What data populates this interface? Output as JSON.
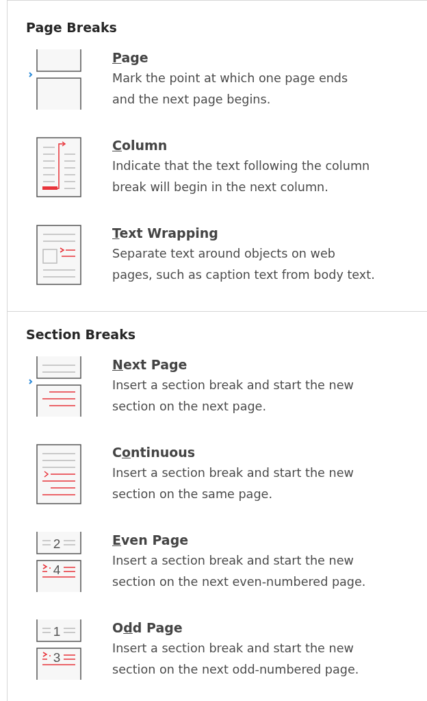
{
  "sections": [
    {
      "heading": "Page Breaks",
      "items": [
        {
          "kind": "page",
          "label": [
            {
              "text": "P",
              "underlined": true
            },
            {
              "text": "age",
              "underlined": false
            }
          ],
          "description": [
            "Mark the point at which one page ends",
            "and the next page begins."
          ]
        },
        {
          "kind": "column",
          "label": [
            {
              "text": "C",
              "underlined": true
            },
            {
              "text": "olumn",
              "underlined": false
            }
          ],
          "description": [
            "Indicate that the text following the column",
            "break will begin in the next column."
          ]
        },
        {
          "kind": "text_wrapping",
          "label": [
            {
              "text": "T",
              "underlined": true
            },
            {
              "text": "ext Wrapping",
              "underlined": false
            }
          ],
          "description": [
            "Separate text around objects on web",
            "pages, such as caption text from body text."
          ]
        }
      ]
    },
    {
      "heading": "Section Breaks",
      "items": [
        {
          "kind": "next_page",
          "label": [
            {
              "text": "N",
              "underlined": true
            },
            {
              "text": "ext Page",
              "underlined": false
            }
          ],
          "description": [
            "Insert a section break and start the new",
            "section on the next page."
          ]
        },
        {
          "kind": "continuous",
          "label": [
            {
              "text": "C",
              "underlined": false
            },
            {
              "text": "o",
              "underlined": true
            },
            {
              "text": "ntinuous",
              "underlined": false
            }
          ],
          "description": [
            "Insert a section break and start the new",
            "section on the same page."
          ]
        },
        {
          "kind": "numbered_page",
          "icon_numbers": [
            "2",
            "4"
          ],
          "label": [
            {
              "text": "E",
              "underlined": true
            },
            {
              "text": "ven Page",
              "underlined": false
            }
          ],
          "description": [
            "Insert a section break and start the new",
            "section on the next even-numbered page."
          ]
        },
        {
          "kind": "numbered_page",
          "icon_numbers": [
            "1",
            "3"
          ],
          "label": [
            {
              "text": "O",
              "underlined": false
            },
            {
              "text": "d",
              "underlined": true
            },
            {
              "text": "d Page",
              "underlined": false
            }
          ],
          "description": [
            "Insert a section break and start the new",
            "section on the next odd-numbered page."
          ]
        }
      ]
    }
  ]
}
